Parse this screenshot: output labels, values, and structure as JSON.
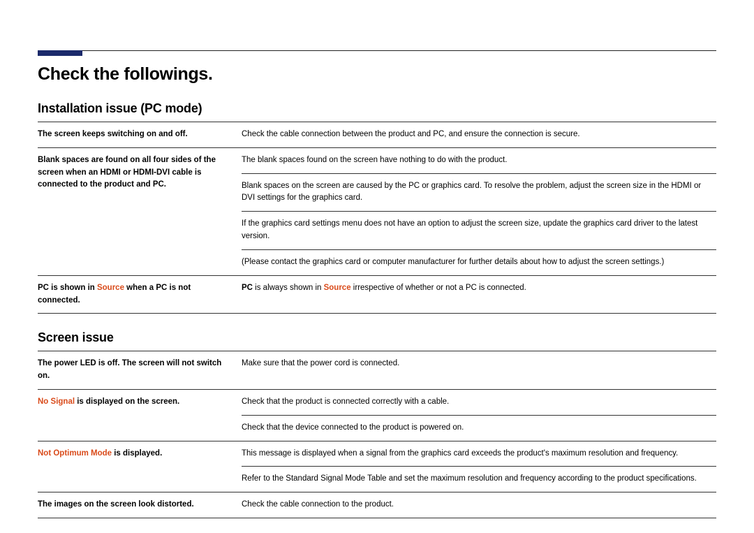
{
  "title": "Check the followings.",
  "section1": {
    "heading": "Installation issue (PC mode)",
    "rows": [
      {
        "left": "The screen keeps switching on and off.",
        "right": [
          "Check the cable connection between the product and PC, and ensure the connection is secure."
        ]
      },
      {
        "left": "Blank spaces are found on all four sides of the screen when an HDMI or HDMI-DVI cable is connected to the product and PC.",
        "right": [
          "The blank spaces found on the screen have nothing to do with the product.",
          "Blank spaces on the screen are caused by the PC or graphics card. To resolve the problem, adjust the screen size in the HDMI or DVI settings for the graphics card.",
          "If the graphics card settings menu does not have an option to adjust the screen size, update the graphics card driver to the latest version.",
          "(Please contact the graphics card or computer manufacturer for further details about how to adjust the screen settings.)"
        ]
      },
      {
        "left_html": "<span class='b'>PC is shown in </span><span class='hl'>Source</span><span class='b'> when a PC is not connected.</span>",
        "right_html": "<span class='b'>PC</span> is always shown in <span class='hl'>Source</span> irrespective of whether or not a PC is connected."
      }
    ]
  },
  "section2": {
    "heading": "Screen issue",
    "rows": [
      {
        "left": "The power LED is off. The screen will not switch on.",
        "right": [
          "Make sure that the power cord is connected."
        ]
      },
      {
        "left_html": "<span class='hl'>No Signal</span><span class='b'> is displayed on the screen.</span>",
        "right": [
          "Check that the product is connected correctly with a cable.",
          "Check that the device connected to the product is powered on."
        ]
      },
      {
        "left_html": "<span class='hl'>Not Optimum Mode</span><span class='b'> is displayed.</span>",
        "right": [
          "This message is displayed when a signal from the graphics card exceeds the product's maximum resolution and frequency.",
          "Refer to the Standard Signal Mode Table and set the maximum resolution and frequency according to the product specifications."
        ]
      },
      {
        "left": "The images on the screen look distorted.",
        "right": [
          "Check the cable connection to the product."
        ]
      }
    ]
  }
}
